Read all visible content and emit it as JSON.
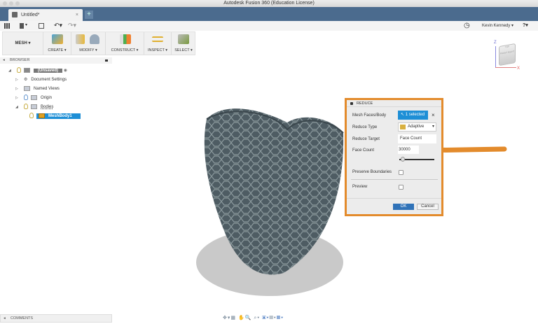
{
  "window": {
    "title": "Autodesk Fusion 360 (Education License)"
  },
  "tab": {
    "label": "Untitled*",
    "close": "×",
    "new": "+"
  },
  "user": {
    "name": "Kevin Kennedy ▾",
    "help": "?▾"
  },
  "qat": {
    "file": "▾",
    "undo": "↶▾",
    "redo": "↷▾"
  },
  "ribbon": {
    "workspace": "MESH ▾",
    "groups": [
      "CREATE ▾",
      "MODIFY ▾",
      "CONSTRUCT ▾",
      "INSPECT ▾",
      "SELECT ▾"
    ]
  },
  "browser": {
    "title": "BROWSER",
    "items": [
      "(Unsaved)",
      "Document Settings",
      "Named Views",
      "Origin",
      "Bodies",
      "MeshBody1"
    ]
  },
  "viewcube": {
    "z": "Z",
    "x": "X",
    "top": "TOP",
    "front": "FRONT",
    "right": "RIGHT"
  },
  "dialog": {
    "title": "REDUCE",
    "mesh_label": "Mesh Faces/Body",
    "mesh_value": "1 selected",
    "reduce_type_label": "Reduce Type",
    "reduce_type_value": "Adaptive",
    "reduce_target_label": "Reduce Target",
    "reduce_target_value": "Face Count",
    "face_count_label": "Face Count",
    "face_count_value": "30000",
    "face_count_slider": 0.05,
    "preserve_label": "Preserve Boundaries",
    "preserve_checked": false,
    "preview_label": "Preview",
    "preview_checked": false,
    "ok": "OK",
    "cancel": "Cancel"
  },
  "comments": {
    "label": "COMMENTS"
  },
  "colors": {
    "accent": "#e38b2c",
    "tabbar": "#4b6b8e",
    "selection": "#1e8fd6",
    "mesh": "#4e5c63"
  }
}
